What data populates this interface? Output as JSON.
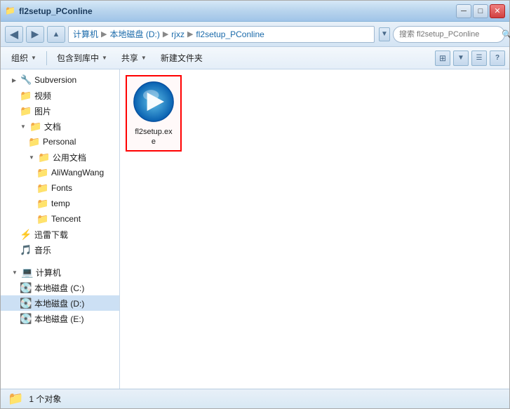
{
  "window": {
    "title": "fl2setup_PConline",
    "title_icon": "📁"
  },
  "titlebar": {
    "minimize_label": "─",
    "maximize_label": "□",
    "close_label": "✕"
  },
  "addressbar": {
    "back_label": "◀",
    "breadcrumb": [
      {
        "label": "计算机",
        "sep": "▶"
      },
      {
        "label": "本地磁盘 (D:)",
        "sep": "▶"
      },
      {
        "label": "rjxz",
        "sep": "▶"
      },
      {
        "label": "fl2setup_PConline",
        "sep": ""
      }
    ],
    "refresh_label": "⟳",
    "search_placeholder": "搜索 fl2setup_PConline",
    "search_icon": "🔍"
  },
  "toolbar": {
    "organize_label": "组织",
    "include_label": "包含到库中",
    "share_label": "共享",
    "new_folder_label": "新建文件夹",
    "dropdown_arrow": "▼",
    "view_icon1": "⊞",
    "view_icon2": "☰",
    "help_label": "?"
  },
  "sidebar": {
    "items": [
      {
        "indent": 1,
        "icon": "🔧",
        "label": "Subversion",
        "arrow": "▶",
        "type": "item"
      },
      {
        "indent": 2,
        "icon": "📁",
        "label": "视频",
        "arrow": "",
        "type": "folder"
      },
      {
        "indent": 2,
        "icon": "📁",
        "label": "图片",
        "arrow": "",
        "type": "folder"
      },
      {
        "indent": 2,
        "icon": "📁",
        "label": "文档",
        "arrow": "▶",
        "type": "folder"
      },
      {
        "indent": 3,
        "icon": "📁",
        "label": "Personal",
        "arrow": "",
        "type": "folder"
      },
      {
        "indent": 3,
        "icon": "📁",
        "label": "公用文档",
        "arrow": "▶",
        "type": "folder"
      },
      {
        "indent": 4,
        "icon": "📁",
        "label": "AliWangWang",
        "arrow": "",
        "type": "folder"
      },
      {
        "indent": 4,
        "icon": "📁",
        "label": "Fonts",
        "arrow": "",
        "type": "folder"
      },
      {
        "indent": 4,
        "icon": "📁",
        "label": "temp",
        "arrow": "",
        "type": "folder"
      },
      {
        "indent": 4,
        "icon": "📁",
        "label": "Tencent",
        "arrow": "",
        "type": "folder"
      },
      {
        "indent": 2,
        "icon": "⚡",
        "label": "迅雷下载",
        "arrow": "",
        "type": "special"
      },
      {
        "indent": 2,
        "icon": "🎵",
        "label": "音乐",
        "arrow": "",
        "type": "music"
      },
      {
        "indent": 0,
        "icon": "",
        "label": "",
        "arrow": "",
        "type": "spacer"
      },
      {
        "indent": 1,
        "icon": "💻",
        "label": "计算机",
        "arrow": "▶",
        "type": "computer"
      },
      {
        "indent": 2,
        "icon": "💽",
        "label": "本地磁盘 (C:)",
        "arrow": "",
        "type": "drive"
      },
      {
        "indent": 2,
        "icon": "💽",
        "label": "本地磁盘 (D:)",
        "arrow": "",
        "type": "drive",
        "selected": true
      },
      {
        "indent": 2,
        "icon": "💽",
        "label": "本地磁盘 (E:)",
        "arrow": "",
        "type": "drive"
      }
    ]
  },
  "files": [
    {
      "name": "fl2setup.exe",
      "display_name": "fl2setup.ex\ne",
      "type": "exe"
    }
  ],
  "statusbar": {
    "icon": "📁",
    "text": "1 个对象"
  }
}
